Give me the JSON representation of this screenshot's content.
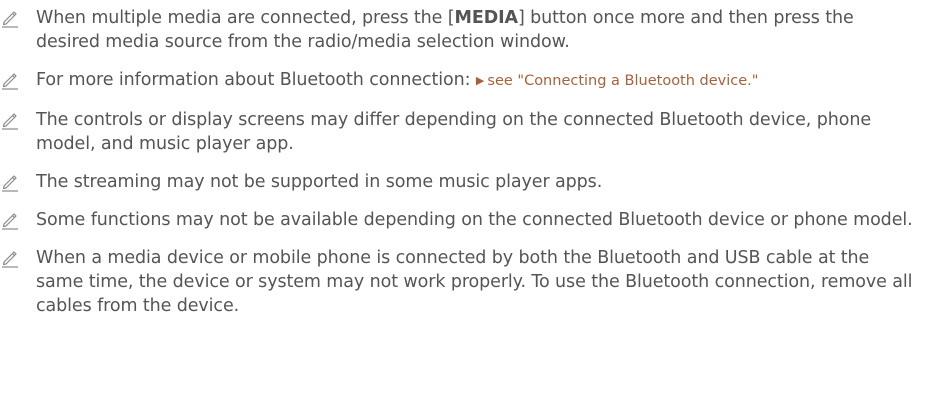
{
  "icon": "pencil-note-icon",
  "colors": {
    "text": "#555555",
    "link": "#a8623a",
    "icon": "#8a8a8a"
  },
  "notes": [
    {
      "before": "When multiple media are connected, press the [",
      "bold": "MEDIA",
      "after": "] button once more and then press the desired media source from the radio/media selection window."
    },
    {
      "text": "For more information about Bluetooth connection:",
      "xref_arrow": "▶",
      "xref": "see \"Connecting a Bluetooth device.\""
    },
    {
      "text": "The controls or display screens may differ depending on the connected Bluetooth device, phone model, and music player app."
    },
    {
      "text": "The streaming may not be supported in some music player apps."
    },
    {
      "text": "Some functions may not be available depending on the connected Bluetooth device or phone model."
    },
    {
      "text": "When a media device or mobile phone is connected by both the Bluetooth and USB cable at the same time, the device or system may not work properly. To use the Bluetooth connection, remove all cables from the device."
    }
  ]
}
